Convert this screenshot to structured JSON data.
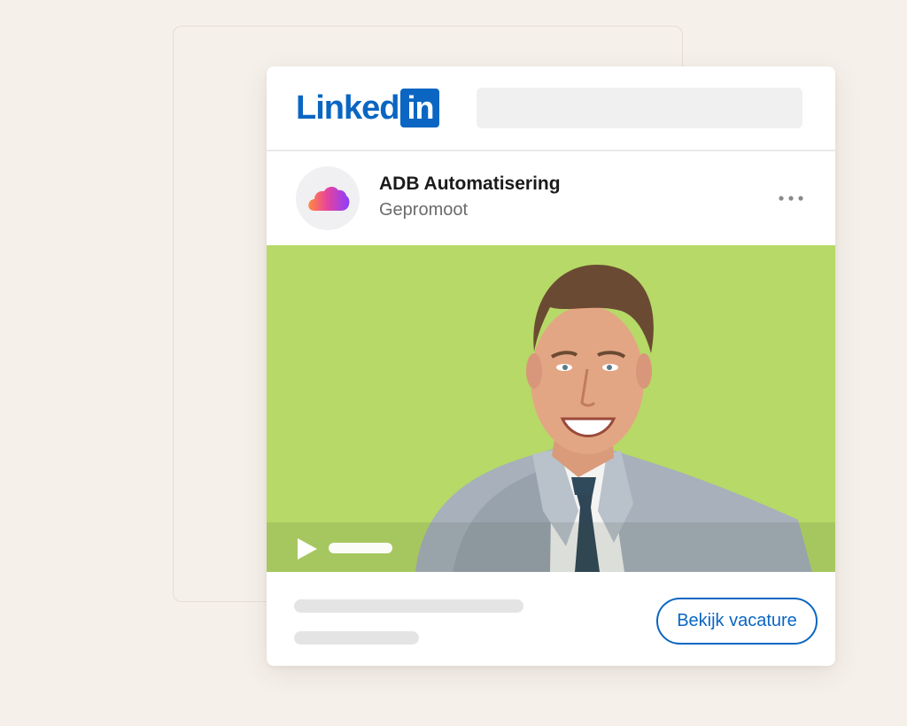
{
  "header": {
    "logo_word": "Linked",
    "logo_badge": "in",
    "search_placeholder": ""
  },
  "post": {
    "company_name": "ADB Automatisering",
    "subtitle": "Gepromoot",
    "more_icon": "more-horizontal-icon",
    "avatar_icon": "cloud-icon",
    "media": {
      "background_color": "#b6d967",
      "play_icon": "play-icon"
    },
    "cta_label": "Bekijk vacature"
  },
  "colors": {
    "brand": "#0a66c2",
    "page_bg": "#f5f0ea",
    "media_bg": "#b6d967"
  }
}
